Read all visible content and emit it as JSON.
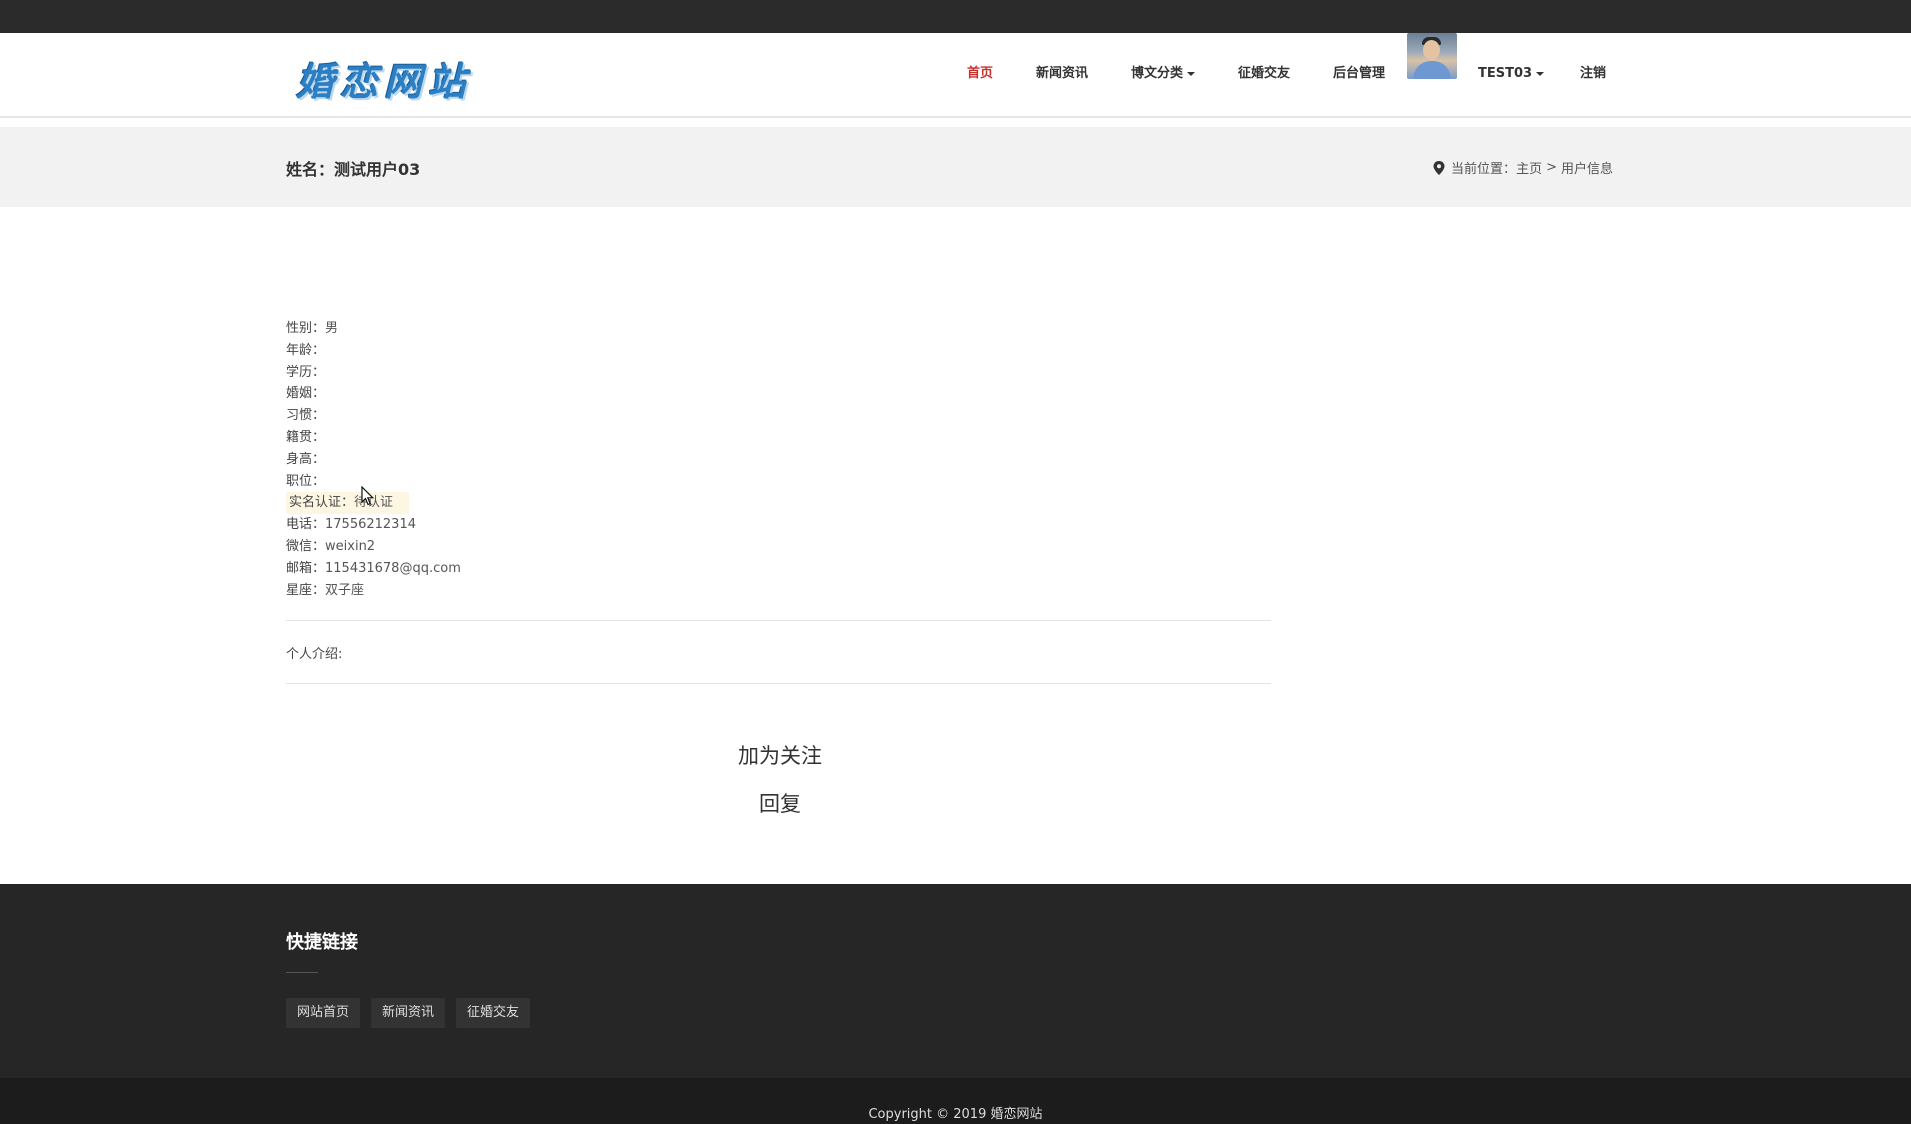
{
  "header": {
    "logo_text": "婚恋网站",
    "nav": [
      {
        "label": "首页",
        "active": true
      },
      {
        "label": "新闻资讯"
      },
      {
        "label": "博文分类"
      },
      {
        "label": "征婚交友"
      },
      {
        "label": "后台管理"
      },
      {
        "label": "TEST03"
      },
      {
        "label": "注销"
      }
    ]
  },
  "titlebar": {
    "title": "姓名：测试用户03",
    "breadcrumb_prefix": "当前位置：",
    "crumb_home": "主页",
    "crumb_sep": ">",
    "crumb_current": "用户信息"
  },
  "profile": {
    "rows": [
      {
        "label": "性别：",
        "value": "男"
      },
      {
        "label": "年龄：",
        "value": ""
      },
      {
        "label": "学历：",
        "value": ""
      },
      {
        "label": "婚姻：",
        "value": ""
      },
      {
        "label": "习惯：",
        "value": ""
      },
      {
        "label": "籍贯：",
        "value": ""
      },
      {
        "label": "身高：",
        "value": ""
      },
      {
        "label": "职位：",
        "value": ""
      },
      {
        "label": "实名认证：",
        "value": "待认证"
      },
      {
        "label": "电话：",
        "value": "17556212314"
      },
      {
        "label": "微信：",
        "value": "weixin2"
      },
      {
        "label": "邮箱：",
        "value": "115431678@qq.com"
      },
      {
        "label": "星座：",
        "value": "双子座"
      }
    ],
    "intro_label": "个人介绍:"
  },
  "actions": {
    "follow": "加为关注",
    "reply": "回复"
  },
  "footer": {
    "title": "快捷链接",
    "links": [
      "网站首页",
      "新闻资讯",
      "征婚交友"
    ],
    "copyright": "Copyright © 2019 婚恋网站"
  },
  "colors": {
    "active_nav": "#c9302c",
    "logo": "#2c7fc3",
    "footer_bg": "#262626"
  }
}
